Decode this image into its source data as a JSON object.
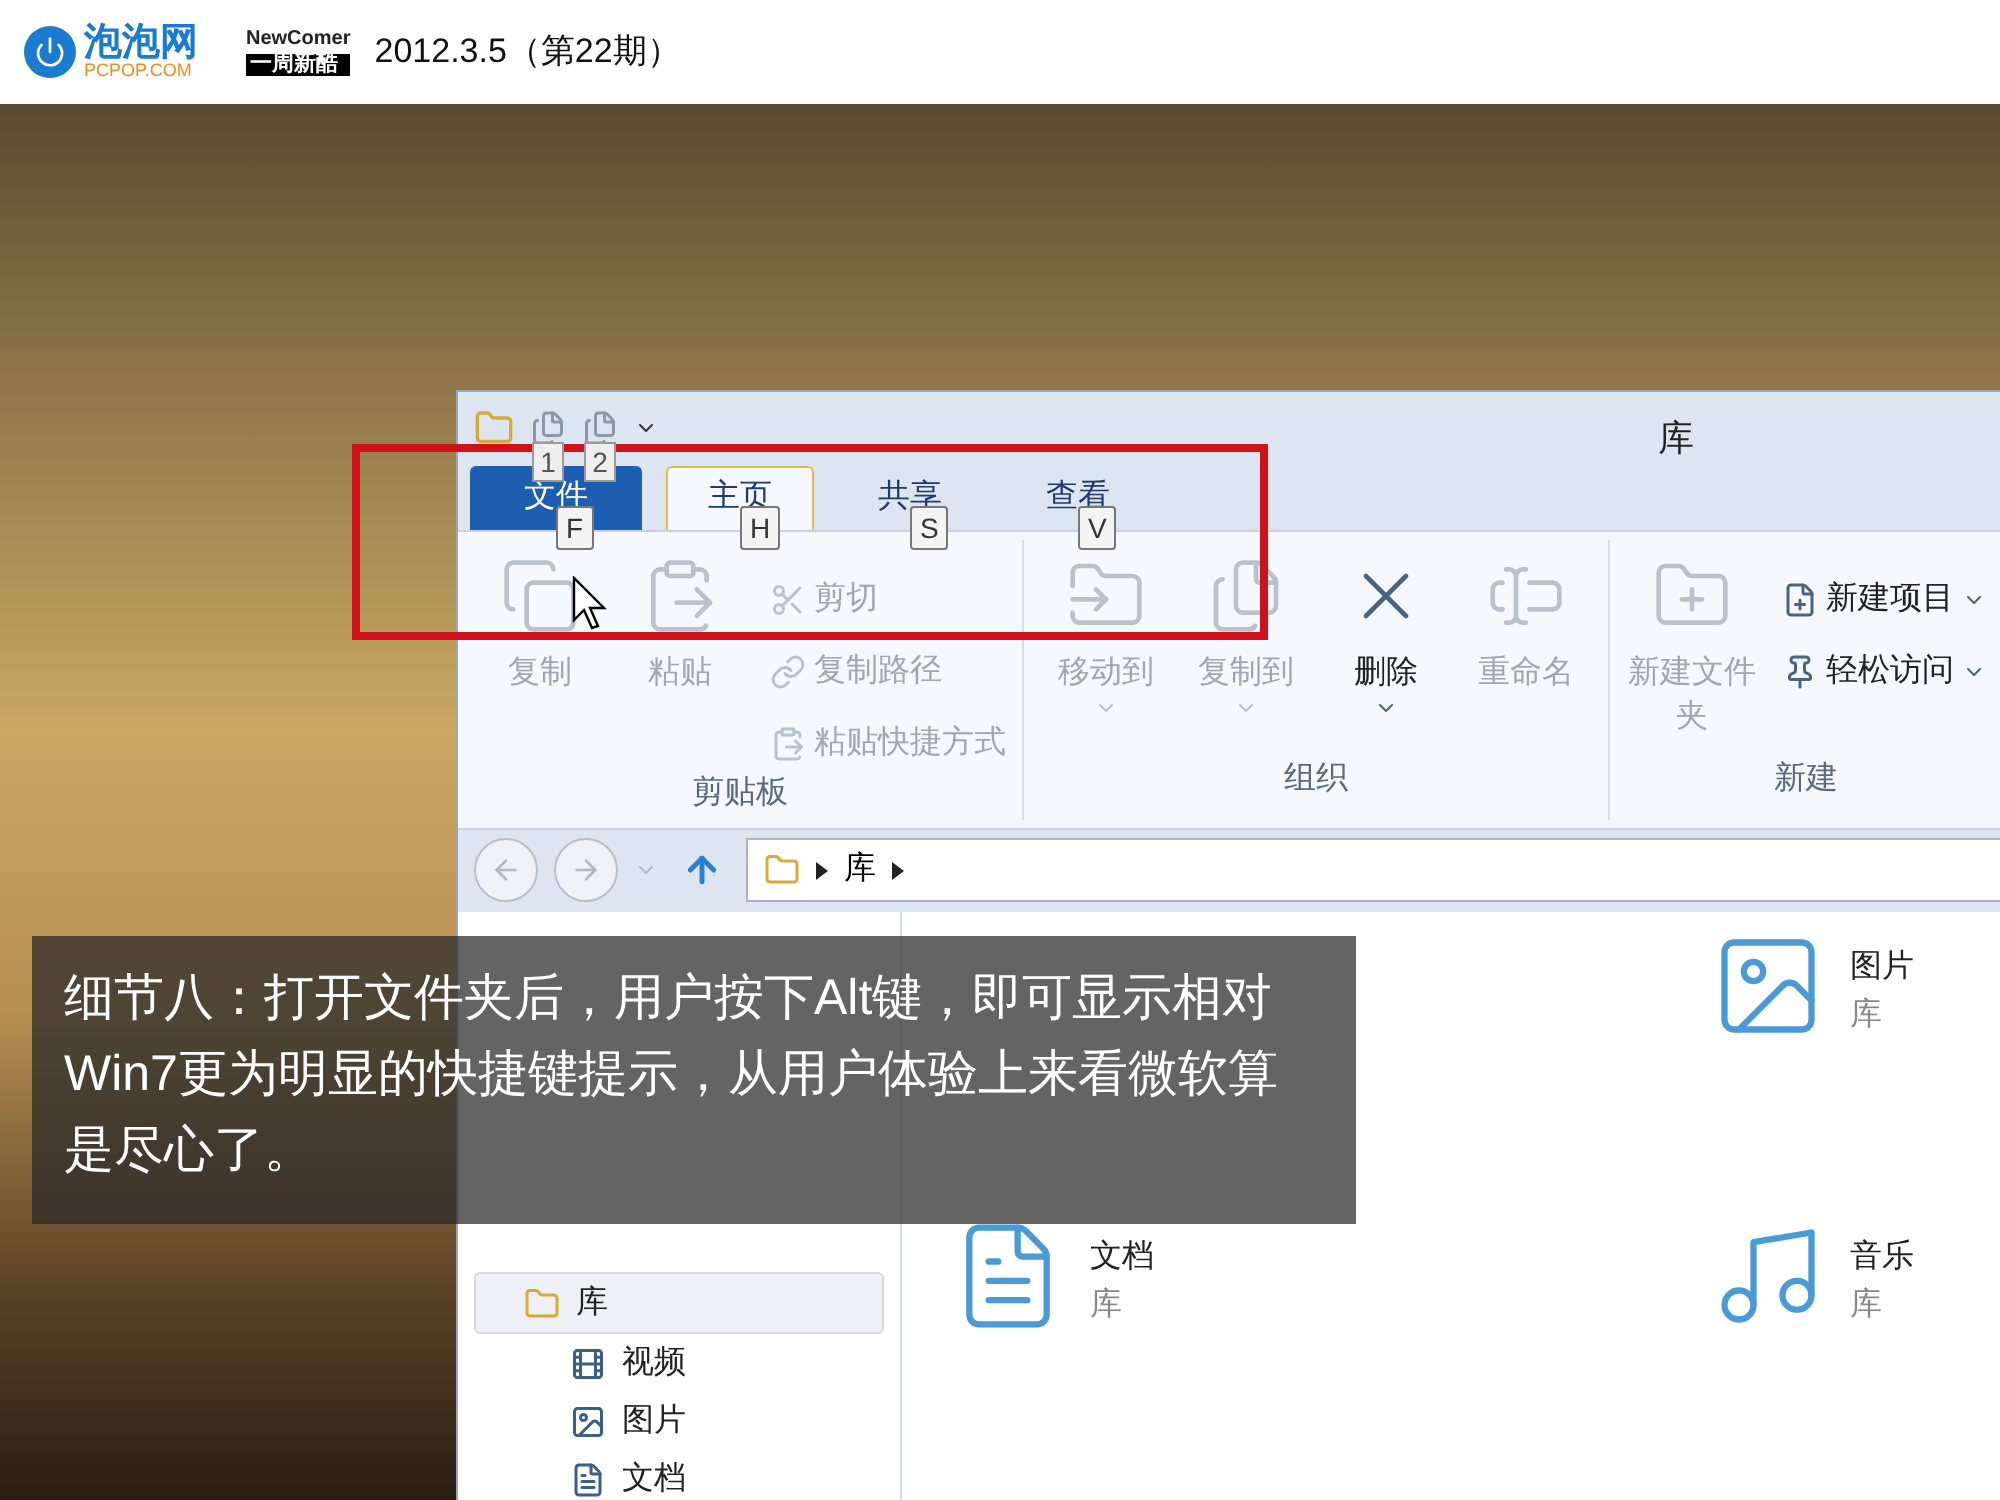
{
  "header": {
    "site_name": "泡泡网",
    "site_domain": "PCPOP.COM",
    "column_brand": "NewComer",
    "column_name": "一周新酷",
    "issue": "2012.3.5（第22期）"
  },
  "window": {
    "title": "库",
    "quick_access_tips": [
      "1",
      "2"
    ],
    "tabs": [
      {
        "label": "文件",
        "kind": "file",
        "key_tip": "F",
        "selected": false
      },
      {
        "label": "主页",
        "kind": "tab",
        "key_tip": "H",
        "selected": true
      },
      {
        "label": "共享",
        "kind": "tab",
        "key_tip": "S",
        "selected": false
      },
      {
        "label": "查看",
        "kind": "tab",
        "key_tip": "V",
        "selected": false
      }
    ],
    "ribbon": [
      {
        "label": "剪贴板",
        "items": [
          {
            "label": "复制",
            "kind": "large",
            "disabled": true,
            "dropdown": false
          },
          {
            "label": "粘贴",
            "kind": "large",
            "disabled": true,
            "dropdown": false
          },
          {
            "label": "剪切",
            "kind": "small",
            "disabled": true,
            "dropdown": false
          },
          {
            "label": "复制路径",
            "kind": "small",
            "disabled": true,
            "dropdown": false
          },
          {
            "label": "粘贴快捷方式",
            "kind": "small",
            "disabled": true,
            "dropdown": false
          }
        ]
      },
      {
        "label": "组织",
        "items": [
          {
            "label": "移动到",
            "kind": "large",
            "disabled": true,
            "dropdown": true
          },
          {
            "label": "复制到",
            "kind": "large",
            "disabled": true,
            "dropdown": true
          },
          {
            "label": "删除",
            "kind": "large",
            "disabled": false,
            "dropdown": true
          },
          {
            "label": "重命名",
            "kind": "large",
            "disabled": true,
            "dropdown": false
          }
        ]
      },
      {
        "label": "新建",
        "items": [
          {
            "label": "新建文件夹",
            "kind": "large",
            "disabled": true,
            "dropdown": false
          },
          {
            "label": "新建项目",
            "kind": "small",
            "disabled": false,
            "dropdown": true
          },
          {
            "label": "轻松访问",
            "kind": "small",
            "disabled": false,
            "dropdown": true
          }
        ]
      }
    ],
    "address": {
      "breadcrumbs": [
        "库"
      ]
    },
    "nav_library": {
      "label": "库",
      "selected": true,
      "children": [
        {
          "label": "视频"
        },
        {
          "label": "图片"
        },
        {
          "label": "文档"
        }
      ]
    },
    "libraries": [
      {
        "name": "图片",
        "sub": "库",
        "kind": "pictures"
      },
      {
        "name": "文档",
        "sub": "库",
        "kind": "documents"
      },
      {
        "name": "音乐",
        "sub": "库",
        "kind": "music"
      }
    ]
  },
  "caption": "细节八：打开文件夹后，用户按下Alt键，即可显示相对Win7更为明显的快捷键提示，从用户体验上来看微软算是尽心了。"
}
